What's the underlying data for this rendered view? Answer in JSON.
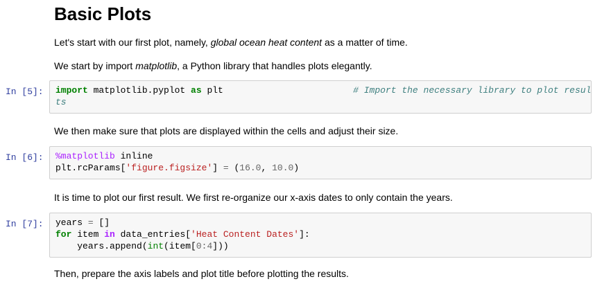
{
  "heading": "Basic Plots",
  "md": {
    "p1_a": "Let's start with our first plot, namely, ",
    "p1_em": "global ocean heat content",
    "p1_b": " as a matter of time.",
    "p2_a": "We start by import ",
    "p2_em": "matplotlib",
    "p2_b": ", a Python library that handles plots elegantly.",
    "p3": "We then make sure that plots are displayed within the cells and adjust their size.",
    "p4": "It is time to plot our first result. We first re-organize our x-axis dates to only contain the years.",
    "p5": "Then, prepare the axis labels and plot title before plotting the results."
  },
  "cells": {
    "c5": {
      "prompt": "In [5]:",
      "kw_import": "import",
      "module": " matplotlib.pyplot ",
      "kw_as": "as",
      "alias": " plt",
      "pad": "                        ",
      "comment_l1": "# Import the necessary library to plot resul",
      "comment_l2": "ts"
    },
    "c6": {
      "prompt": "In [6]:",
      "magic": "%matplotlib",
      "magic_arg": " inline",
      "l2_a": "plt.rcParams[",
      "l2_str": "'figure.figsize'",
      "l2_b": "] ",
      "l2_eq": "=",
      "l2_c": " (",
      "l2_n1": "16.0",
      "l2_d": ", ",
      "l2_n2": "10.0",
      "l2_e": ")"
    },
    "c7": {
      "prompt": "In [7]:",
      "l1_a": "years ",
      "l1_eq": "=",
      "l1_b": " []",
      "kw_for": "for",
      "l2_a": " item ",
      "kw_in": "in",
      "l2_b": " data_entries[",
      "l2_str": "'Heat Content Dates'",
      "l2_c": "]:",
      "l3_indent": "    ",
      "l3_a": "years.append(",
      "l3_int": "int",
      "l3_b": "(item[",
      "l3_n0": "0",
      "l3_colon": ":",
      "l3_n4": "4",
      "l3_c": "]))"
    }
  }
}
